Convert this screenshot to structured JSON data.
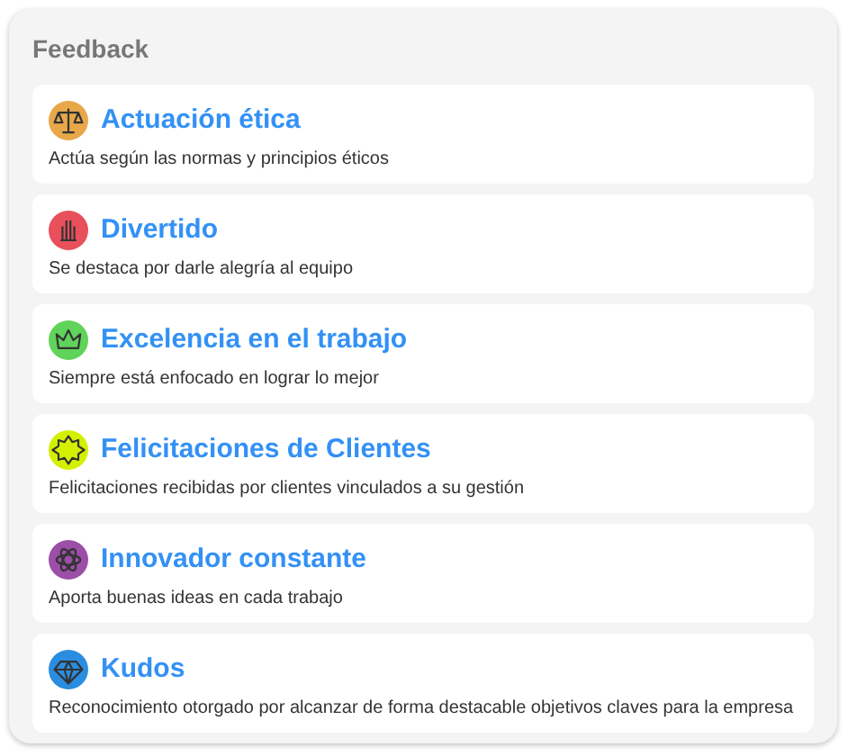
{
  "panel": {
    "title": "Feedback"
  },
  "items": [
    {
      "title": "Actuación ética",
      "description": "Actúa según las normas y principios éticos",
      "color": "#e8a84a",
      "kind": "scales"
    },
    {
      "title": "Divertido",
      "description": "Se destaca por darle alegría al equipo",
      "color": "#e8505b",
      "kind": "hand"
    },
    {
      "title": "Excelencia en el trabajo",
      "description": "Siempre está enfocado en lograr lo mejor",
      "color": "#5fd35a",
      "kind": "crown"
    },
    {
      "title": "Felicitaciones de Clientes",
      "description": "Felicitaciones recibidas por clientes vinculados a su gestión",
      "color": "#d4f000",
      "kind": "burst"
    },
    {
      "title": "Innovador constante",
      "description": "Aporta buenas ideas en cada trabajo",
      "color": "#9b4fa6",
      "kind": "atom"
    },
    {
      "title": "Kudos",
      "description": "Reconocimiento otorgado por alcanzar de forma destacable objetivos claves para la empresa",
      "color": "#2a8de0",
      "kind": "diamond"
    }
  ]
}
